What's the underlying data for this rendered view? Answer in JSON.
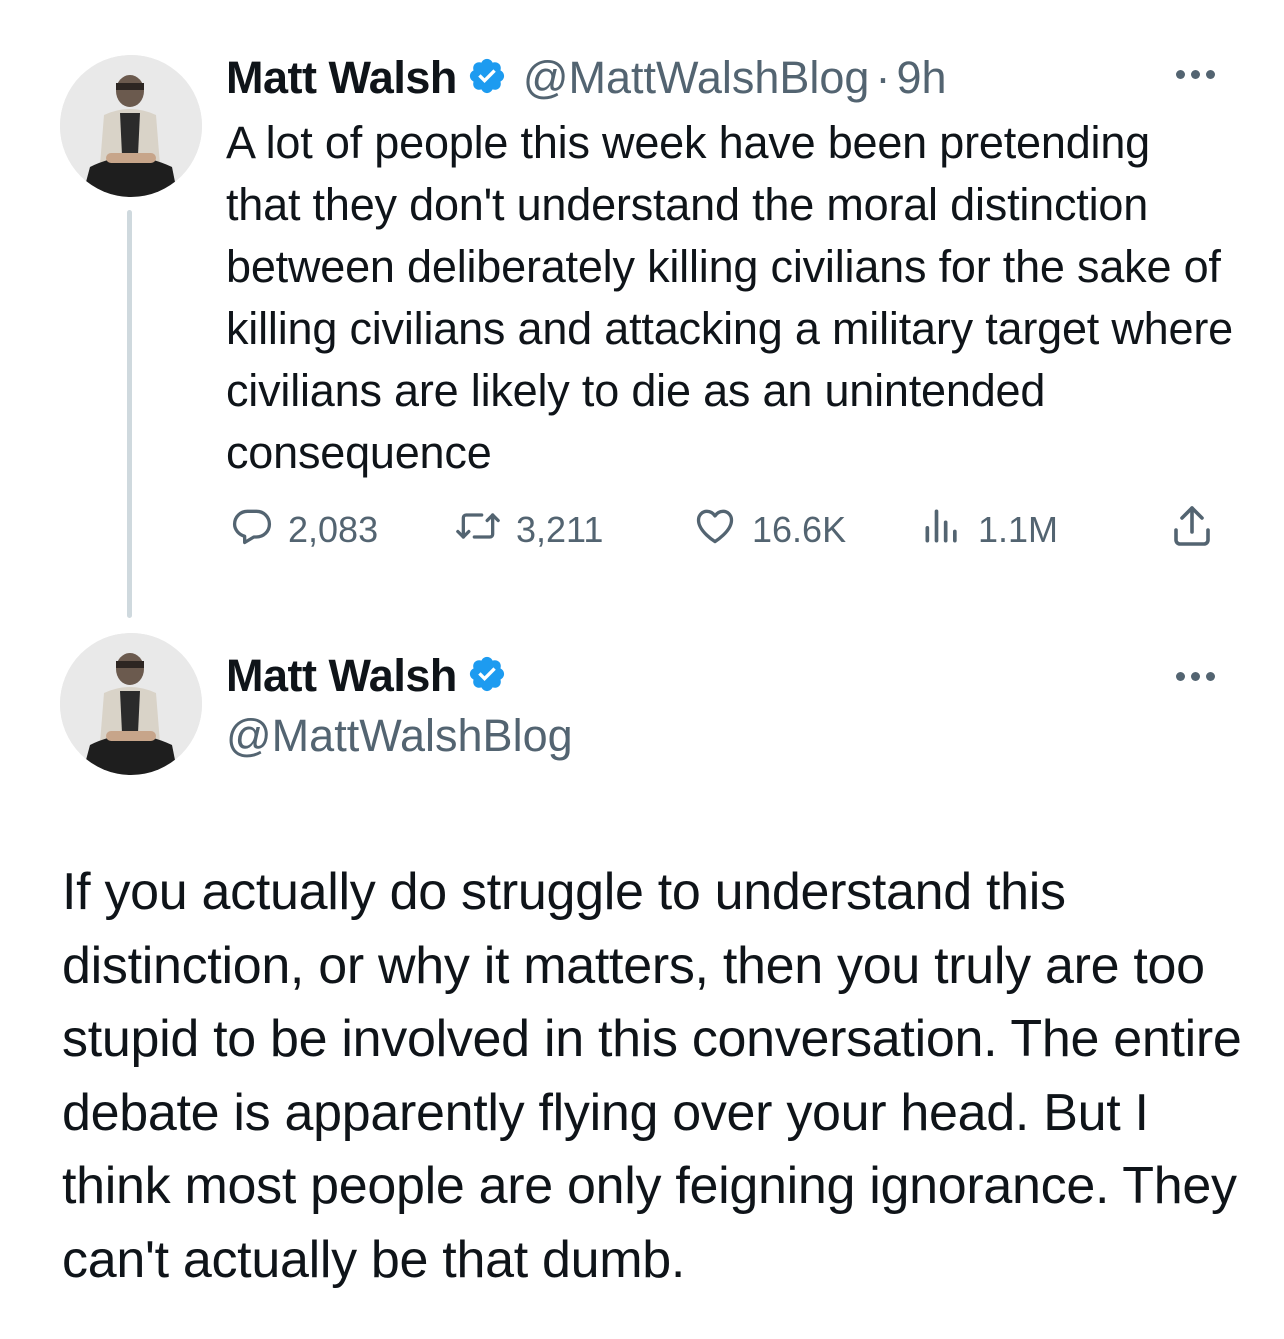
{
  "tweet1": {
    "author_name": "Matt Walsh",
    "handle": "@MattWalshBlog",
    "separator": "·",
    "time": "9h",
    "text": "A lot of people this week have been pretending that they don't understand the moral distinction between deliberately killing civilians for the sake of killing civilians and attacking a military target where civilians are likely to die as an unintended consequence",
    "actions": {
      "replies": "2,083",
      "retweets": "3,211",
      "likes": "16.6K",
      "views": "1.1M"
    }
  },
  "tweet2": {
    "author_name": "Matt Walsh",
    "handle": "@MattWalshBlog",
    "text": "If you actually do struggle to understand this distinction, or why it matters, then you truly are too stupid to be involved in this conversation. The entire debate is apparently flying over your head. But I think most people are only feigning ignorance. They can't actually be that dumb."
  },
  "icons": {
    "verified": "verified-badge-icon",
    "more": "more-options-icon",
    "reply": "reply-icon",
    "retweet": "retweet-icon",
    "like": "heart-icon",
    "views": "views-icon",
    "share": "share-icon"
  },
  "colors": {
    "text": "#0f1419",
    "secondary": "#536471",
    "verified": "#1d9bf0",
    "thread_line": "#cfd9de"
  }
}
